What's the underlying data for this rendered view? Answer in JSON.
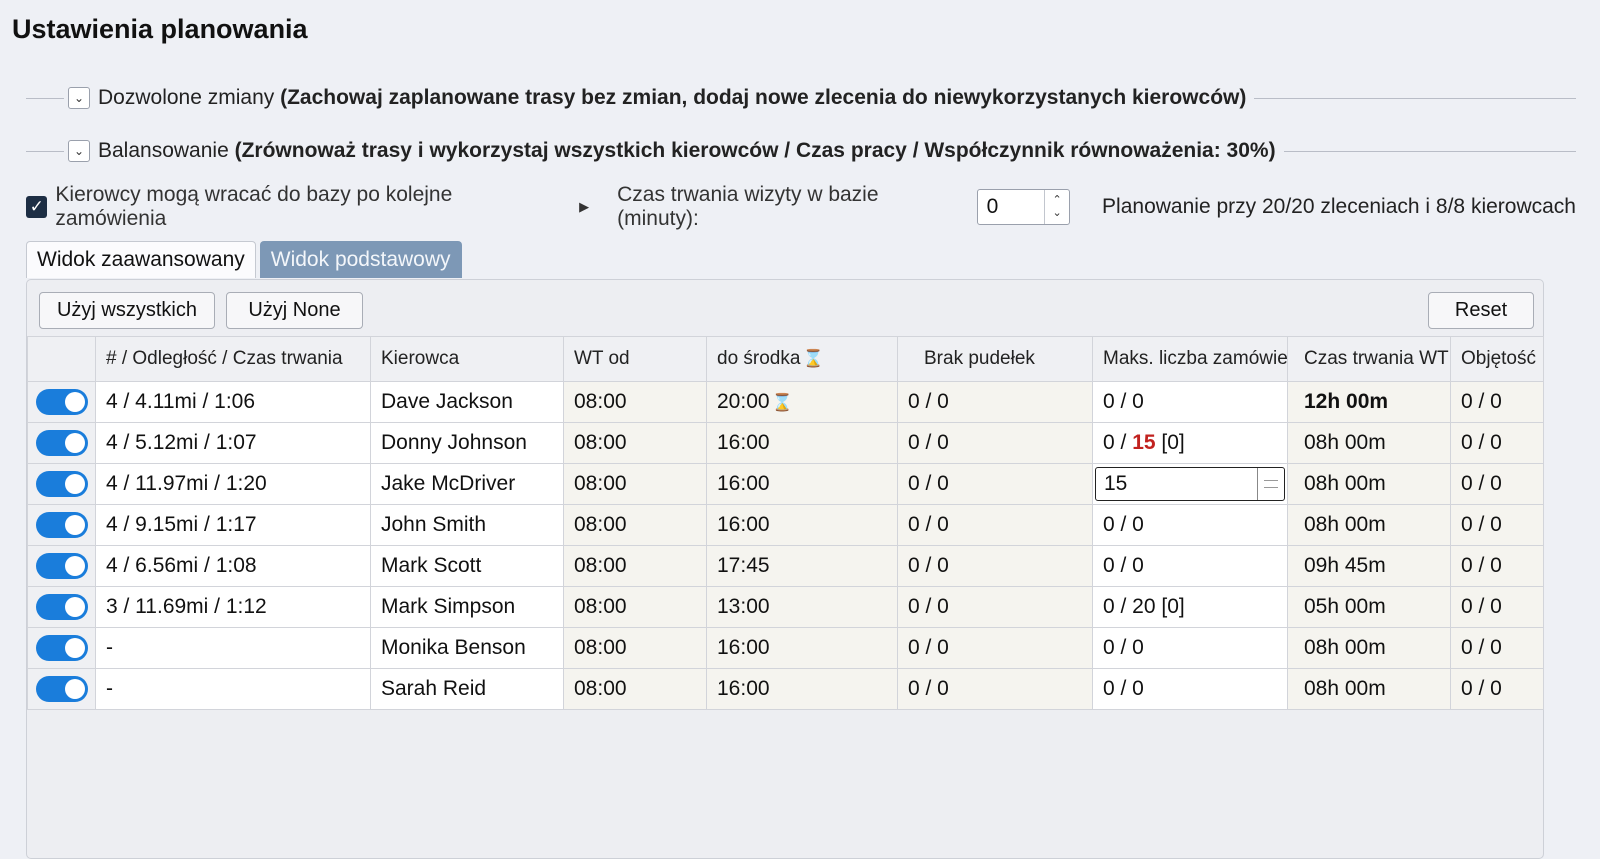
{
  "page_title": "Ustawienia planowania",
  "sections": [
    {
      "label": "Dozwolone zmiany",
      "detail": "(Zachowaj zaplanowane trasy bez zmian, dodaj nowe zlecenia do niewykorzystanych kierowców)"
    },
    {
      "label": "Balansowanie",
      "detail": "(Zrównoważ trasy i wykorzystaj wszystkich kierowców / Czas pracy / Współczynnik równoważenia: 30%)"
    }
  ],
  "options": {
    "return_to_base_label": "Kierowcy mogą wracać do bazy po kolejne zamówienia",
    "return_to_base_checked": true,
    "visit_duration_label": "Czas trwania wizyty w bazie (minuty):",
    "visit_duration_value": "0",
    "plan_summary": "Planowanie przy 20/20 zleceniach i 8/8 kierowcach"
  },
  "tabs": [
    {
      "label": "Widok zaawansowany",
      "active": true
    },
    {
      "label": "Widok podstawowy",
      "active": false
    }
  ],
  "toolbar": {
    "use_all_label": "Użyj wszystkich",
    "use_none_label": "Użyj None",
    "reset_label": "Reset"
  },
  "table": {
    "headers": {
      "distance": "# / Odległość / Czas trwania",
      "driver": "Kierowca",
      "wt_from": "WT od",
      "to_center": "do środka",
      "missing_boxes": "Brak pudełek",
      "max_orders": "Maks. liczba zamówień",
      "wt_duration": "Czas trwania WT",
      "volume": "Objętość"
    },
    "rows": [
      {
        "enabled": true,
        "distance": "4 / 4.11mi / 1:06",
        "driver": "Dave Jackson",
        "wt_from": "08:00",
        "to_center": "20:00",
        "missing_boxes": "0 / 0",
        "max_orders": "0 / 0",
        "wt_duration": "12h 00m",
        "volume": "0 / 0"
      },
      {
        "enabled": true,
        "distance": "4 / 5.12mi / 1:07",
        "driver": "Donny Johnson",
        "wt_from": "08:00",
        "to_center": "16:00",
        "missing_boxes": "0 / 0",
        "max_orders_prefix": "0 / ",
        "max_orders_highlight": "15",
        "max_orders_suffix": " [0]",
        "wt_duration": "08h 00m",
        "volume": "0 / 0"
      },
      {
        "enabled": true,
        "distance": "4 / 11.97mi / 1:20",
        "driver": "Jake McDriver",
        "wt_from": "08:00",
        "to_center": "16:00",
        "missing_boxes": "0 / 0",
        "max_orders_input": "15",
        "wt_duration": "08h 00m",
        "volume": "0 / 0"
      },
      {
        "enabled": true,
        "distance": "4 / 9.15mi / 1:17",
        "driver": "John Smith",
        "wt_from": "08:00",
        "to_center": "16:00",
        "missing_boxes": "0 / 0",
        "max_orders": "0 / 0",
        "wt_duration": "08h 00m",
        "volume": "0 / 0"
      },
      {
        "enabled": true,
        "distance": "4 / 6.56mi / 1:08",
        "driver": "Mark Scott",
        "wt_from": "08:00",
        "to_center": "17:45",
        "missing_boxes": "0 / 0",
        "max_orders": "0 / 0",
        "wt_duration": "09h 45m",
        "volume": "0 / 0"
      },
      {
        "enabled": true,
        "distance": "3 / 11.69mi / 1:12",
        "driver": "Mark Simpson",
        "wt_from": "08:00",
        "to_center": "13:00",
        "missing_boxes": "0 / 0",
        "max_orders": "0 / 20 [0]",
        "wt_duration": "05h 00m",
        "volume": "0 / 0"
      },
      {
        "enabled": true,
        "distance": "-",
        "driver": "Monika Benson",
        "wt_from": "08:00",
        "to_center": "16:00",
        "missing_boxes": "0 / 0",
        "max_orders": "0 / 0",
        "wt_duration": "08h 00m",
        "volume": "0 / 0"
      },
      {
        "enabled": true,
        "distance": "-",
        "driver": "Sarah Reid",
        "wt_from": "08:00",
        "to_center": "16:00",
        "missing_boxes": "0 / 0",
        "max_orders": "0 / 0",
        "wt_duration": "08h 00m",
        "volume": "0 / 0"
      }
    ]
  },
  "colors": {
    "toggle_on": "#1a7ddb",
    "highlight_red": "#c1221f",
    "tab_inactive": "#7d98b6"
  },
  "icons": {
    "section_expand": "chevron-down-icon",
    "checkbox": "checkmark-icon",
    "expand_arrow": "triangle-right-icon",
    "time_limit": "hourglass-icon"
  }
}
